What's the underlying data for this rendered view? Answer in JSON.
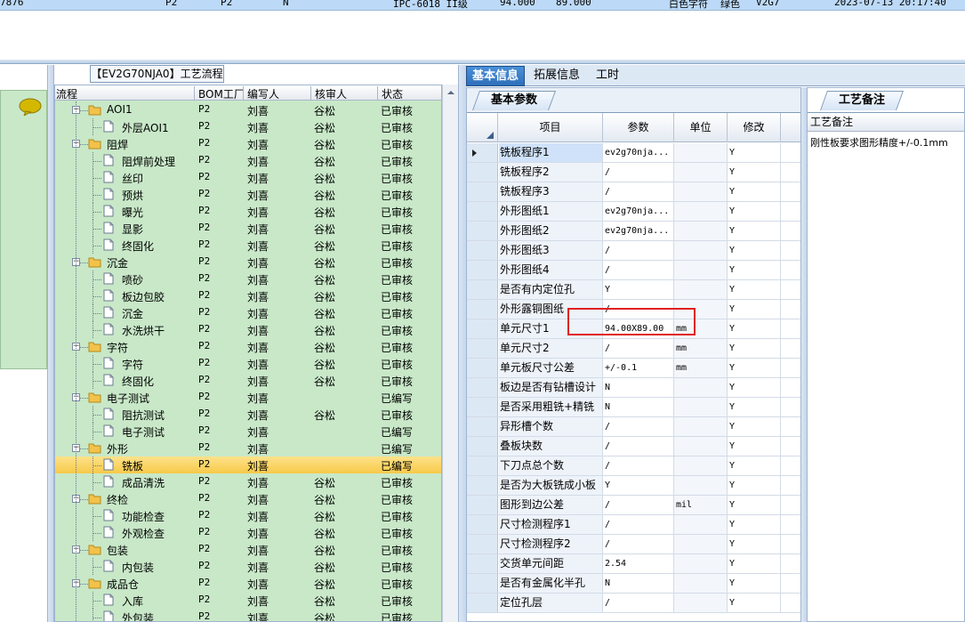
{
  "top_record": {
    "id": "7876",
    "col1": "P2",
    "col2": "P2",
    "col3": "N",
    "spec": "IPC-6018 II级",
    "w": "94.000",
    "h": "89.000",
    "silk": "白色字符",
    "mask": "绿色",
    "code": "V2G7",
    "time": "2023-07-13 20:17:40"
  },
  "process_panel": {
    "title": "【EV2G70NJA0】工艺流程",
    "columns": {
      "flow": "流程",
      "bom": "BOM工厂",
      "editor": "编写人",
      "reviewer": "核审人",
      "status": "状态"
    },
    "rows": [
      {
        "name": "AOI1",
        "bom": "P2",
        "editor": "刘喜",
        "reviewer": "谷松",
        "status": "已审核",
        "level": 1,
        "expanded": true
      },
      {
        "name": "外层AOI1",
        "bom": "P2",
        "editor": "刘喜",
        "reviewer": "谷松",
        "status": "已审核",
        "level": 2
      },
      {
        "name": "阻焊",
        "bom": "P2",
        "editor": "刘喜",
        "reviewer": "谷松",
        "status": "已审核",
        "level": 1,
        "expanded": true
      },
      {
        "name": "阻焊前处理",
        "bom": "P2",
        "editor": "刘喜",
        "reviewer": "谷松",
        "status": "已审核",
        "level": 2
      },
      {
        "name": "丝印",
        "bom": "P2",
        "editor": "刘喜",
        "reviewer": "谷松",
        "status": "已审核",
        "level": 2
      },
      {
        "name": "预烘",
        "bom": "P2",
        "editor": "刘喜",
        "reviewer": "谷松",
        "status": "已审核",
        "level": 2
      },
      {
        "name": "曝光",
        "bom": "P2",
        "editor": "刘喜",
        "reviewer": "谷松",
        "status": "已审核",
        "level": 2
      },
      {
        "name": "显影",
        "bom": "P2",
        "editor": "刘喜",
        "reviewer": "谷松",
        "status": "已审核",
        "level": 2
      },
      {
        "name": "终固化",
        "bom": "P2",
        "editor": "刘喜",
        "reviewer": "谷松",
        "status": "已审核",
        "level": 2
      },
      {
        "name": "沉金",
        "bom": "P2",
        "editor": "刘喜",
        "reviewer": "谷松",
        "status": "已审核",
        "level": 1,
        "expanded": true
      },
      {
        "name": "喷砂",
        "bom": "P2",
        "editor": "刘喜",
        "reviewer": "谷松",
        "status": "已审核",
        "level": 2
      },
      {
        "name": "板边包胶",
        "bom": "P2",
        "editor": "刘喜",
        "reviewer": "谷松",
        "status": "已审核",
        "level": 2
      },
      {
        "name": "沉金",
        "bom": "P2",
        "editor": "刘喜",
        "reviewer": "谷松",
        "status": "已审核",
        "level": 2
      },
      {
        "name": "水洗烘干",
        "bom": "P2",
        "editor": "刘喜",
        "reviewer": "谷松",
        "status": "已审核",
        "level": 2
      },
      {
        "name": "字符",
        "bom": "P2",
        "editor": "刘喜",
        "reviewer": "谷松",
        "status": "已审核",
        "level": 1,
        "expanded": true
      },
      {
        "name": "字符",
        "bom": "P2",
        "editor": "刘喜",
        "reviewer": "谷松",
        "status": "已审核",
        "level": 2
      },
      {
        "name": "终固化",
        "bom": "P2",
        "editor": "刘喜",
        "reviewer": "谷松",
        "status": "已审核",
        "level": 2
      },
      {
        "name": "电子测试",
        "bom": "P2",
        "editor": "刘喜",
        "reviewer": "",
        "status": "已编写",
        "level": 1,
        "expanded": true
      },
      {
        "name": "阻抗测试",
        "bom": "P2",
        "editor": "刘喜",
        "reviewer": "谷松",
        "status": "已审核",
        "level": 2
      },
      {
        "name": "电子测试",
        "bom": "P2",
        "editor": "刘喜",
        "reviewer": "",
        "status": "已编写",
        "level": 2
      },
      {
        "name": "外形",
        "bom": "P2",
        "editor": "刘喜",
        "reviewer": "",
        "status": "已编写",
        "level": 1,
        "expanded": true
      },
      {
        "name": "铣板",
        "bom": "P2",
        "editor": "刘喜",
        "reviewer": "",
        "status": "已编写",
        "level": 2,
        "selected": true
      },
      {
        "name": "成品清洗",
        "bom": "P2",
        "editor": "刘喜",
        "reviewer": "谷松",
        "status": "已审核",
        "level": 2
      },
      {
        "name": "终检",
        "bom": "P2",
        "editor": "刘喜",
        "reviewer": "谷松",
        "status": "已审核",
        "level": 1,
        "expanded": true
      },
      {
        "name": "功能检查",
        "bom": "P2",
        "editor": "刘喜",
        "reviewer": "谷松",
        "status": "已审核",
        "level": 2
      },
      {
        "name": "外观检查",
        "bom": "P2",
        "editor": "刘喜",
        "reviewer": "谷松",
        "status": "已审核",
        "level": 2
      },
      {
        "name": "包装",
        "bom": "P2",
        "editor": "刘喜",
        "reviewer": "谷松",
        "status": "已审核",
        "level": 1,
        "expanded": true
      },
      {
        "name": "内包装",
        "bom": "P2",
        "editor": "刘喜",
        "reviewer": "谷松",
        "status": "已审核",
        "level": 2
      },
      {
        "name": "成品仓",
        "bom": "P2",
        "editor": "刘喜",
        "reviewer": "谷松",
        "status": "已审核",
        "level": 1,
        "expanded": true
      },
      {
        "name": "入库",
        "bom": "P2",
        "editor": "刘喜",
        "reviewer": "谷松",
        "status": "已审核",
        "level": 2
      },
      {
        "name": "外包装",
        "bom": "P2",
        "editor": "刘喜",
        "reviewer": "谷松",
        "status": "已审核",
        "level": 2
      }
    ]
  },
  "tabs": [
    "基本信息",
    "拓展信息",
    "工时"
  ],
  "active_tab": 0,
  "basic_params": {
    "subtab": "基本参数",
    "columns": {
      "item": "项目",
      "param": "参数",
      "unit": "单位",
      "modify": "修改"
    },
    "rows": [
      {
        "item": "铣板程序1",
        "param": "ev2g70nja...",
        "unit": "",
        "modify": "Y",
        "current": true
      },
      {
        "item": "铣板程序2",
        "param": "/",
        "unit": "",
        "modify": "Y"
      },
      {
        "item": "铣板程序3",
        "param": "/",
        "unit": "",
        "modify": "Y"
      },
      {
        "item": "外形图纸1",
        "param": "ev2g70nja...",
        "unit": "",
        "modify": "Y"
      },
      {
        "item": "外形图纸2",
        "param": "ev2g70nja...",
        "unit": "",
        "modify": "Y"
      },
      {
        "item": "外形图纸3",
        "param": "/",
        "unit": "",
        "modify": "Y"
      },
      {
        "item": "外形图纸4",
        "param": "/",
        "unit": "",
        "modify": "Y"
      },
      {
        "item": "是否有内定位孔",
        "param": "Y",
        "unit": "",
        "modify": "Y"
      },
      {
        "item": "外形露铜图纸",
        "param": "/",
        "unit": "",
        "modify": "Y"
      },
      {
        "item": "单元尺寸1",
        "param": "94.00X89.00",
        "unit": "mm",
        "modify": "Y"
      },
      {
        "item": "单元尺寸2",
        "param": "/",
        "unit": "mm",
        "modify": "Y"
      },
      {
        "item": "单元板尺寸公差",
        "param": "+/-0.1",
        "unit": "mm",
        "modify": "Y"
      },
      {
        "item": "板边是否有钻槽设计",
        "param": "N",
        "unit": "",
        "modify": "Y"
      },
      {
        "item": "是否采用粗铣+精铣",
        "param": "N",
        "unit": "",
        "modify": "Y"
      },
      {
        "item": "异形槽个数",
        "param": "/",
        "unit": "",
        "modify": "Y"
      },
      {
        "item": "叠板块数",
        "param": "/",
        "unit": "",
        "modify": "Y"
      },
      {
        "item": "下刀点总个数",
        "param": "/",
        "unit": "",
        "modify": "Y"
      },
      {
        "item": "是否为大板铣成小板",
        "param": "Y",
        "unit": "",
        "modify": "Y"
      },
      {
        "item": "图形到边公差",
        "param": "/",
        "unit": "mil",
        "modify": "Y"
      },
      {
        "item": "尺寸检测程序1",
        "param": "/",
        "unit": "",
        "modify": "Y"
      },
      {
        "item": "尺寸检测程序2",
        "param": "/",
        "unit": "",
        "modify": "Y"
      },
      {
        "item": "交货单元间距",
        "param": "2.54",
        "unit": "",
        "modify": "Y"
      },
      {
        "item": "是否有金属化半孔",
        "param": "N",
        "unit": "",
        "modify": "Y"
      },
      {
        "item": "定位孔层",
        "param": "/",
        "unit": "",
        "modify": "Y"
      }
    ]
  },
  "process_notes": {
    "tab": "工艺备注",
    "header": "工艺备注",
    "text": "刚性板要求图形精度+/-0.1mm"
  },
  "colors": {
    "tree_bg": "#c8e8c8",
    "selected_row": "#f7c948",
    "active_tab": "#2f6fb9",
    "highlight_box": "#e02020"
  }
}
